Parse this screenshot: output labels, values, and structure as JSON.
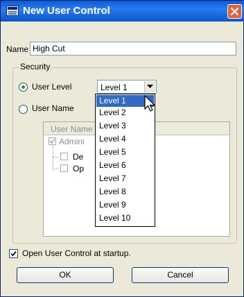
{
  "window": {
    "title": "New User Control",
    "icon": "app-window-icon",
    "close_icon": "close-icon"
  },
  "name": {
    "label": "Name",
    "value": "High Cut"
  },
  "security": {
    "legend": "Security",
    "user_level_label": "User Level",
    "user_name_label": "User Name",
    "selected_option": "User Level",
    "level_value": "Level 1"
  },
  "dropdown": {
    "items": [
      "Level 1",
      "Level 2",
      "Level 3",
      "Level 4",
      "Level 5",
      "Level 6",
      "Level 7",
      "Level 8",
      "Level 9",
      "Level 10"
    ],
    "selected": "Level 1"
  },
  "user_table": {
    "header_visible": "User Name",
    "row_admin_visible": "Admini",
    "row_de_visible": "De",
    "row_op_visible": "Op"
  },
  "startup": {
    "label": "Open User Control at startup.",
    "checked": true
  },
  "buttons": {
    "ok": "OK",
    "cancel": "Cancel"
  },
  "colors": {
    "title_bar": "#0a5bd6",
    "dialog_bg": "#ece9d8",
    "selection": "#316ac5",
    "close": "#e2633a"
  }
}
